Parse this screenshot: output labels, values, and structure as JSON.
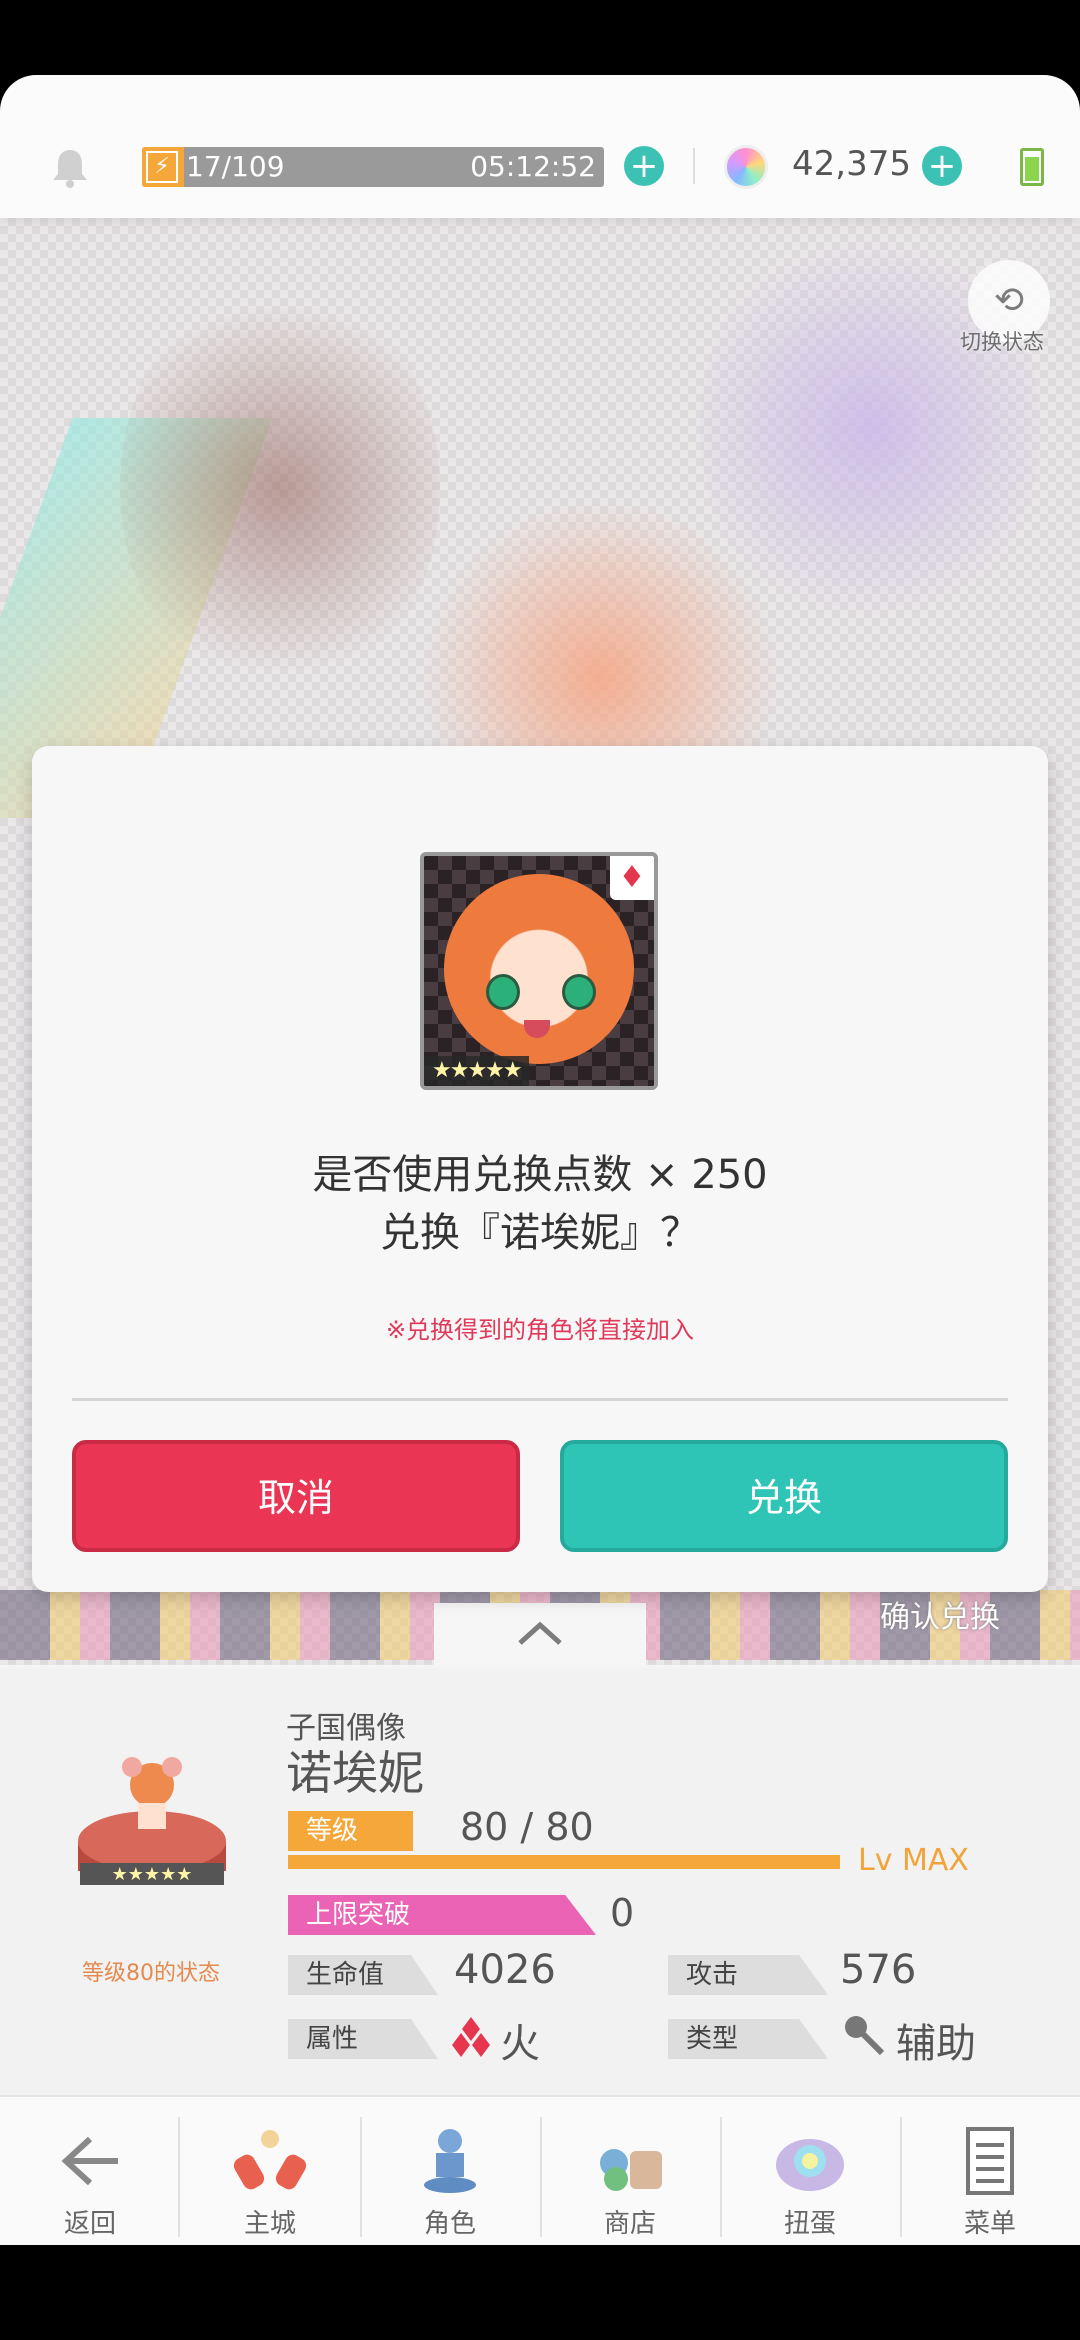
{
  "status_bar": {
    "energy": "17/109",
    "energy_timer": "05:12:52",
    "gems": "42,375"
  },
  "hero": {
    "switch_label": "切换状态",
    "confirm_hint": "确认兑换"
  },
  "dialog": {
    "question_line1": "是否使用兑换点数 × 250",
    "question_line2": "兑换『诺埃妮』？",
    "note": "※兑换得到的角色将直接加入",
    "cancel_label": "取消",
    "confirm_label": "兑换",
    "portrait_suit": "♦",
    "portrait_stars": "★★★★★"
  },
  "character": {
    "role": "子国偶像",
    "name": "诺埃妮",
    "sprite_caption": "等级80的状态",
    "level_tag": "等级",
    "level_value": "80 / 80",
    "level_max": "Lv MAX",
    "level_progress": 1.0,
    "limit_break_tag": "上限突破",
    "limit_break_value": "0",
    "hp_tag": "生命值",
    "hp_value": "4026",
    "atk_tag": "攻击",
    "atk_value": "576",
    "attr_tag": "属性",
    "attr_value": "火",
    "type_tag": "类型",
    "type_value": "辅助"
  },
  "nav": {
    "back": "返回",
    "town": "主城",
    "character": "角色",
    "shop": "商店",
    "gacha": "扭蛋",
    "menu": "菜单"
  },
  "colors": {
    "cancel": "#ea3554",
    "confirm": "#2ec5b6",
    "level": "#f6a73a",
    "limit_break": "#ea63b4"
  }
}
